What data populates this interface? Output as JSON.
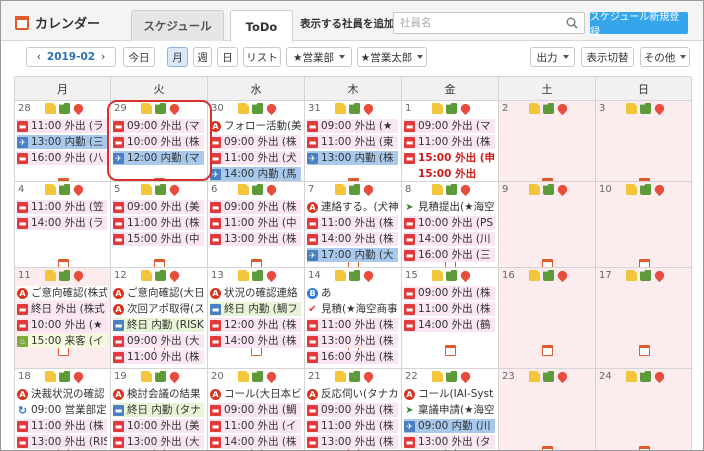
{
  "app": {
    "title": "カレンダー"
  },
  "tabs": {
    "schedule": "スケジュール",
    "todo": "ToDo"
  },
  "header": {
    "add_employee_label": "表示する社員を追加",
    "search_placeholder": "社員名",
    "new_schedule_button": "スケジュール新規登録"
  },
  "toolbar": {
    "month": "2019-02",
    "today": "今日",
    "views": [
      "月",
      "週",
      "日",
      "リスト"
    ],
    "department": "★営業部",
    "person": "★営業太郎",
    "output": "出力",
    "toggle_display": "表示切替",
    "other": "その他"
  },
  "weekdays": [
    "月",
    "火",
    "水",
    "木",
    "金",
    "土",
    "日"
  ],
  "weeks": [
    [
      {
        "day": "28",
        "events": [
          {
            "kind": "out",
            "text": "11:00 外出 (ラ"
          },
          {
            "kind": "inn",
            "text": "13:00 内勤 (三"
          },
          {
            "kind": "out",
            "text": "16:00 外出 (八"
          }
        ]
      },
      {
        "day": "29",
        "events": [
          {
            "kind": "out",
            "text": "09:00 外出 (マ"
          },
          {
            "kind": "out",
            "text": "10:00 外出 (株"
          },
          {
            "kind": "inn",
            "text": "12:00 内勤 (マ"
          }
        ]
      },
      {
        "day": "30",
        "events": [
          {
            "kind": "task",
            "text": "フォロー活動(美"
          },
          {
            "kind": "out",
            "text": "09:00 外出 (株"
          },
          {
            "kind": "out",
            "text": "11:00 外出 (犬"
          },
          {
            "kind": "inn",
            "text": "14:00 内勤 (馬"
          }
        ]
      },
      {
        "day": "31",
        "events": [
          {
            "kind": "out",
            "text": "09:00 外出 (★"
          },
          {
            "kind": "out",
            "text": "11:00 外出 (東"
          },
          {
            "kind": "inn",
            "text": "13:00 内勤 (株"
          }
        ]
      },
      {
        "day": "1",
        "events": [
          {
            "kind": "out",
            "text": "09:00 外出 (マ"
          },
          {
            "kind": "out",
            "text": "11:00 外出 (株"
          },
          {
            "kind": "red",
            "text": "15:00 外出 (申"
          },
          {
            "kind": "red2",
            "text": "15:00 外出"
          }
        ]
      },
      {
        "day": "2",
        "weekend": true,
        "events": []
      },
      {
        "day": "3",
        "weekend": true,
        "events": []
      }
    ],
    [
      {
        "day": "4",
        "events": [
          {
            "kind": "out",
            "text": "11:00 外出 (笠"
          },
          {
            "kind": "out",
            "text": "14:00 外出 (ラ"
          }
        ]
      },
      {
        "day": "5",
        "events": [
          {
            "kind": "out",
            "text": "09:00 外出 (美"
          },
          {
            "kind": "out",
            "text": "11:00 外出 (株"
          },
          {
            "kind": "out",
            "text": "15:00 外出 (中"
          }
        ]
      },
      {
        "day": "6",
        "events": [
          {
            "kind": "out",
            "text": "09:00 外出 (株"
          },
          {
            "kind": "out",
            "text": "11:00 外出 (中"
          },
          {
            "kind": "out",
            "text": "13:00 外出 (株"
          }
        ]
      },
      {
        "day": "7",
        "events": [
          {
            "kind": "task",
            "text": "連絡する。(犬神"
          },
          {
            "kind": "out",
            "text": "11:00 外出 (株"
          },
          {
            "kind": "out",
            "text": "14:00 外出 (株"
          },
          {
            "kind": "inn",
            "text": "17:00 内勤 (大"
          }
        ]
      },
      {
        "day": "8",
        "events": [
          {
            "kind": "truck",
            "text": "見積提出(★海空"
          },
          {
            "kind": "out",
            "text": "10:00 外出 (PS"
          },
          {
            "kind": "out",
            "text": "14:00 外出 (川"
          },
          {
            "kind": "out",
            "text": "16:00 外出 (三"
          }
        ]
      },
      {
        "day": "9",
        "weekend": true,
        "events": []
      },
      {
        "day": "10",
        "weekend": true,
        "events": []
      }
    ],
    [
      {
        "day": "11",
        "weekend": true,
        "events": [
          {
            "kind": "task",
            "text": "ご意向確認(株式"
          },
          {
            "kind": "out",
            "text": "終日 外出 (株式"
          },
          {
            "kind": "out",
            "text": "10:00 外出 (★"
          },
          {
            "kind": "visit",
            "text": "15:00 来客 (イ"
          }
        ]
      },
      {
        "day": "12",
        "events": [
          {
            "kind": "task",
            "text": "ご意向確認(大日"
          },
          {
            "kind": "task",
            "text": "次回アポ取得(ス"
          },
          {
            "kind": "lg",
            "text": "終日 内勤 (RISK"
          },
          {
            "kind": "out",
            "text": "09:00 外出 (大"
          },
          {
            "kind": "out",
            "text": "11:00 外出 (株"
          }
        ]
      },
      {
        "day": "13",
        "events": [
          {
            "kind": "task",
            "text": "状況の確認連絡"
          },
          {
            "kind": "lg",
            "text": "終日 内勤 (鯛フ"
          },
          {
            "kind": "out",
            "text": "12:00 外出 (株"
          },
          {
            "kind": "out",
            "text": "14:00 外出 (株"
          }
        ]
      },
      {
        "day": "14",
        "events": [
          {
            "kind": "blue",
            "icon": "B",
            "text": "あ"
          },
          {
            "kind": "check",
            "text": "見積(★海空商事"
          },
          {
            "kind": "out",
            "text": "11:00 外出 (株"
          },
          {
            "kind": "out",
            "text": "13:00 外出 (株"
          },
          {
            "kind": "out",
            "text": "16:00 外出 (株"
          }
        ]
      },
      {
        "day": "15",
        "events": [
          {
            "kind": "out",
            "text": "09:00 外出 (株"
          },
          {
            "kind": "out",
            "text": "11:00 外出 (株"
          },
          {
            "kind": "out",
            "text": "14:00 外出 (鶴"
          }
        ]
      },
      {
        "day": "16",
        "weekend": true,
        "events": []
      },
      {
        "day": "17",
        "weekend": true,
        "events": []
      }
    ],
    [
      {
        "day": "18",
        "events": [
          {
            "kind": "task",
            "text": "決裁状況の確認"
          },
          {
            "kind": "rep",
            "text": "09:00 営業部定"
          },
          {
            "kind": "out",
            "text": "11:00 外出 (株"
          },
          {
            "kind": "out",
            "text": "13:00 外出 (RIS"
          }
        ]
      },
      {
        "day": "19",
        "events": [
          {
            "kind": "task",
            "text": "検討会議の結果"
          },
          {
            "kind": "lg",
            "text": "終日 内勤 (タナ"
          },
          {
            "kind": "out",
            "text": "10:00 外出 (美"
          },
          {
            "kind": "out",
            "text": "13:00 外出 (大"
          }
        ]
      },
      {
        "day": "20",
        "events": [
          {
            "kind": "task",
            "text": "コール(大日本ビ"
          },
          {
            "kind": "out",
            "text": "09:00 外出 (鯛"
          },
          {
            "kind": "out",
            "text": "11:00 外出 (イ"
          },
          {
            "kind": "out",
            "text": "14:00 外出 (株"
          }
        ]
      },
      {
        "day": "21",
        "events": [
          {
            "kind": "task",
            "text": "反応伺い(タナカ"
          },
          {
            "kind": "out",
            "text": "09:00 外出 (株"
          },
          {
            "kind": "out",
            "text": "11:00 外出 (株"
          },
          {
            "kind": "out",
            "text": "13:00 外出 (株"
          }
        ]
      },
      {
        "day": "22",
        "events": [
          {
            "kind": "task",
            "text": "コール(IAI-Syst"
          },
          {
            "kind": "truck",
            "text": "稟議申請(★海空"
          },
          {
            "kind": "inn",
            "text": "09:00 内勤 (川"
          },
          {
            "kind": "out",
            "text": "13:00 外出 (タ"
          }
        ]
      },
      {
        "day": "23",
        "weekend": true,
        "events": []
      },
      {
        "day": "24",
        "weekend": true,
        "events": []
      }
    ]
  ]
}
